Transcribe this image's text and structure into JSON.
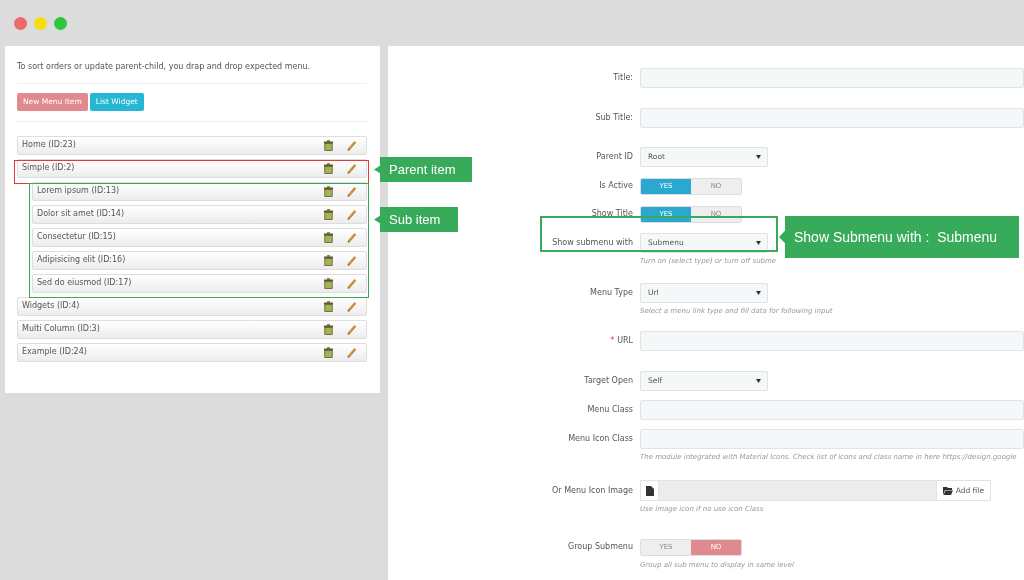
{
  "window": {
    "controls": [
      {
        "color": "#ec6a6e"
      },
      {
        "color": "#f6de0c"
      },
      {
        "color": "#2ec63f"
      }
    ]
  },
  "menu_panel": {
    "instruction": "To sort orders or update parent-child, you drap and drop expected menu.",
    "buttons": [
      {
        "label": "New Menu Item",
        "kind": "danger"
      },
      {
        "label": "List Widget",
        "kind": "info"
      }
    ],
    "items": [
      {
        "label": "Home (ID:23)"
      },
      {
        "label": "Simple (ID:2)",
        "children": [
          {
            "label": "Lorem ipsum (ID:13)"
          },
          {
            "label": "Dolor sit amet (ID:14)"
          },
          {
            "label": "Consectetur (ID:15)"
          },
          {
            "label": "Adipisicing elit (ID:16)"
          },
          {
            "label": "Sed do eiusmod (ID:17)"
          }
        ]
      },
      {
        "label": "Widgets (ID:4)"
      },
      {
        "label": "Multi Column (ID:3)"
      },
      {
        "label": "Example (ID:24)"
      }
    ]
  },
  "form": {
    "fields": [
      {
        "kind": "text",
        "label": "Title:"
      },
      {
        "kind": "text",
        "label": "Sub Title:"
      },
      {
        "kind": "select",
        "label": "Parent ID",
        "value": "Root"
      },
      {
        "kind": "toggle",
        "label": "Is Active",
        "options": [
          {
            "label": "YES",
            "selected": true
          },
          {
            "label": "NO",
            "selected": false
          }
        ]
      },
      {
        "kind": "toggle",
        "label": "Show Title",
        "options": [
          {
            "label": "YES",
            "selected": true
          },
          {
            "label": "NO",
            "selected": false
          }
        ]
      },
      {
        "kind": "select",
        "label": "Show submenu with",
        "value": "Submenu",
        "hint": "Turn on (select type) or turn off subme"
      },
      {
        "kind": "select",
        "label": "Menu Type",
        "value": "Url",
        "hint": "Select a menu link type and fill data for following input"
      },
      {
        "kind": "text",
        "label": "URL",
        "required_mark": "*"
      },
      {
        "kind": "select",
        "label": "Target Open",
        "value": "Self"
      },
      {
        "kind": "text",
        "label": "Menu Class"
      },
      {
        "kind": "text",
        "label": "Menu Icon Class",
        "hint": "The module integrated with Material Icons. Check list of icons and class name in here ",
        "hint_link": "https://design.google"
      },
      {
        "kind": "file",
        "label": "Or Menu Icon Image",
        "button": "Add file",
        "hint": "Use image icon if no use icon Class"
      },
      {
        "kind": "toggle",
        "label": "Group Submenu",
        "options": [
          {
            "label": "YES",
            "selected": false
          },
          {
            "label": "NO",
            "selected": true
          }
        ],
        "hint": "Group all sub menu to display in same level"
      }
    ]
  },
  "annotations": [
    {
      "text": "Parent item"
    },
    {
      "text": "Sub item"
    },
    {
      "text": "Show Submenu with :  Submenu"
    }
  ]
}
